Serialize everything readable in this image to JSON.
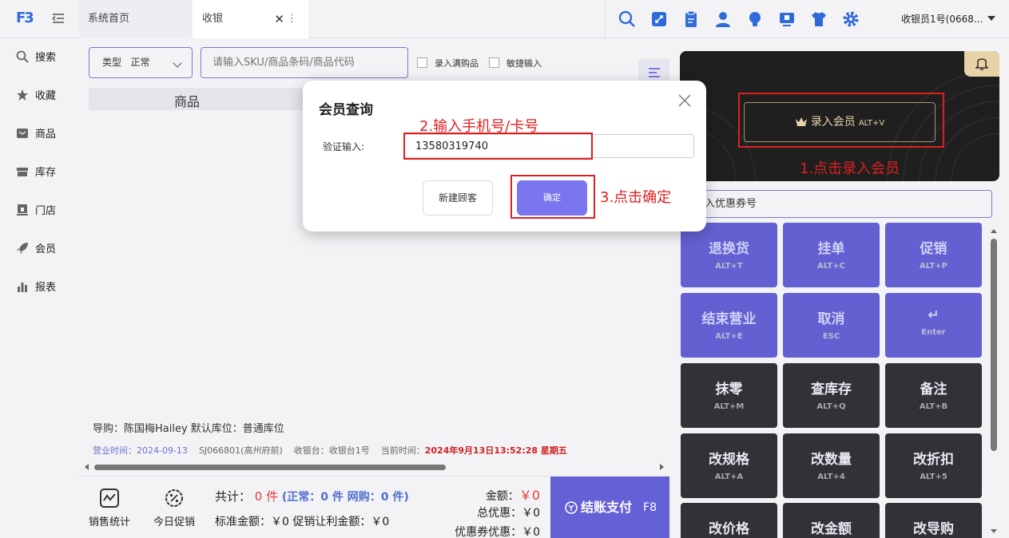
{
  "header": {
    "logo": "F3",
    "tabs": [
      {
        "label": "系统首页"
      },
      {
        "label": "收银"
      }
    ],
    "close_glyph": "✕",
    "more_glyph": "⋮",
    "user": "收银员1号(0668..."
  },
  "sidebar": {
    "items": [
      {
        "label": "搜索",
        "icon": "search-icon"
      },
      {
        "label": "收藏",
        "icon": "star-icon"
      },
      {
        "label": "商品",
        "icon": "product-icon"
      },
      {
        "label": "库存",
        "icon": "inventory-icon"
      },
      {
        "label": "门店",
        "icon": "store-icon"
      },
      {
        "label": "会员",
        "icon": "rocket-icon"
      },
      {
        "label": "报表",
        "icon": "chart-icon"
      }
    ]
  },
  "main": {
    "type_label": "类型",
    "type_value": "正常",
    "sku_placeholder": "请输入SKU/商品条码/商品代码",
    "check_gift": "录入满购品",
    "check_quick": "敏捷输入",
    "table_header": "商品",
    "guide": "导购：陈国梅Hailey   默认库位：普通库位",
    "biz_time_label": "营业时间：2024-09-13",
    "store": "SJ066801(高州府前)",
    "register": "收银台：收银台1号",
    "current_time_label": "当前时间：",
    "current_time": "2024年9月13日13:52:28 星期五"
  },
  "bottom": {
    "sales_stats": "销售统计",
    "today_promo": "今日促销",
    "total_label": "共计：",
    "total_count": "0 件",
    "total_detail": "(正常：0 件  网购：0 件)",
    "std_line": "标准金额：￥0  促销让利金额：￥0",
    "amount_label": "金额：",
    "amount_value": "￥0",
    "discount_line": "总优惠：￥0",
    "coupon_discount_line": "优惠券优惠：￥0",
    "pay_label": "结账支付",
    "pay_key": "F8"
  },
  "right": {
    "member_btn": "录入会员",
    "member_key": "ALT+V",
    "coupon_placeholder": "入优惠券号",
    "buttons": [
      {
        "label": "退换货",
        "key": "ALT+T"
      },
      {
        "label": "挂单",
        "key": "ALT+C"
      },
      {
        "label": "促销",
        "key": "ALT+P"
      },
      {
        "label": "结束营业",
        "key": "ALT+E"
      },
      {
        "label": "取消",
        "key": "ESC"
      },
      {
        "label": "↵",
        "key": "Enter"
      },
      {
        "label": "抹零",
        "key": "ALT+M"
      },
      {
        "label": "查库存",
        "key": "ALT+Q"
      },
      {
        "label": "备注",
        "key": "ALT+B"
      },
      {
        "label": "改规格",
        "key": "ALT+A"
      },
      {
        "label": "改数量",
        "key": "ALT+4"
      },
      {
        "label": "改折扣",
        "key": "ALT+5"
      },
      {
        "label": "改价格",
        "key": ""
      },
      {
        "label": "改金额",
        "key": ""
      },
      {
        "label": "改导购",
        "key": ""
      }
    ]
  },
  "modal": {
    "title": "会员查询",
    "field_label": "验证输入:",
    "field_value": "13580319740",
    "new_customer": "新建顾客",
    "confirm": "确定"
  },
  "annotations": {
    "step1": "1.点击录入会员",
    "step2": "2.输入手机号/卡号",
    "step3": "3.点击确定",
    "color": "#e02020"
  },
  "colors": {
    "accent": "#6460d6",
    "dark_button": "#303236",
    "gold": "#e8d3a8"
  }
}
